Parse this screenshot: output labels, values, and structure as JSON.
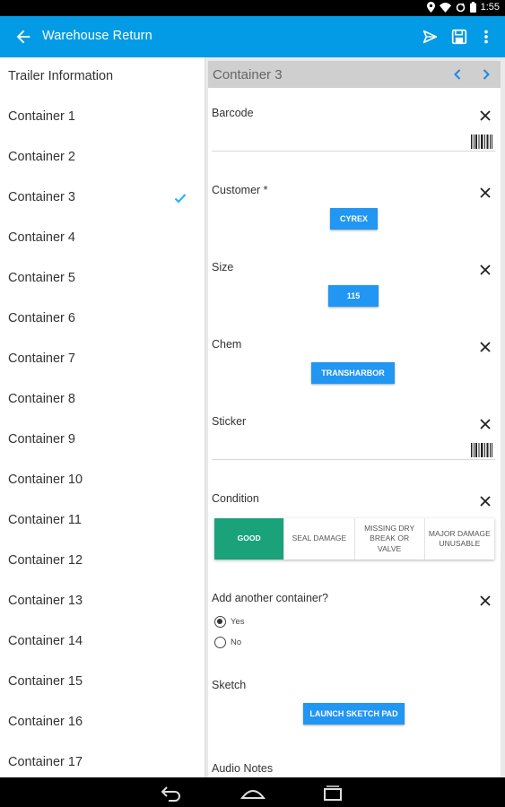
{
  "status_bar": {
    "time": "1:55",
    "icons": [
      "location-icon",
      "wifi-icon",
      "sync-icon",
      "battery-icon"
    ]
  },
  "app_bar": {
    "title": "Warehouse Return",
    "background": "#039be5",
    "actions": [
      "send-icon",
      "save-icon",
      "more-vert-icon"
    ]
  },
  "sidebar": {
    "items": [
      {
        "label": "Trailer Information",
        "checked": false
      },
      {
        "label": "Container 1",
        "checked": false
      },
      {
        "label": "Container 2",
        "checked": false
      },
      {
        "label": "Container 3",
        "checked": true
      },
      {
        "label": "Container 4",
        "checked": false
      },
      {
        "label": "Container 5",
        "checked": false
      },
      {
        "label": "Container 6",
        "checked": false
      },
      {
        "label": "Container 7",
        "checked": false
      },
      {
        "label": "Container 8",
        "checked": false
      },
      {
        "label": "Container 9",
        "checked": false
      },
      {
        "label": "Container 10",
        "checked": false
      },
      {
        "label": "Container 11",
        "checked": false
      },
      {
        "label": "Container 12",
        "checked": false
      },
      {
        "label": "Container 13",
        "checked": false
      },
      {
        "label": "Container 14",
        "checked": false
      },
      {
        "label": "Container 15",
        "checked": false
      },
      {
        "label": "Container 16",
        "checked": false
      },
      {
        "label": "Container 17",
        "checked": false
      }
    ]
  },
  "panel": {
    "title": "Container 3",
    "fields": {
      "barcode": {
        "label": "Barcode",
        "value": ""
      },
      "customer": {
        "label": "Customer *",
        "value": "CYREX"
      },
      "size": {
        "label": "Size",
        "value": "115"
      },
      "chem": {
        "label": "Chem",
        "value": "TRANSHARBOR"
      },
      "sticker": {
        "label": "Sticker",
        "value": ""
      },
      "condition": {
        "label": "Condition",
        "options": [
          "GOOD",
          "SEAL DAMAGE",
          "MISSING DRY BREAK OR VALVE",
          "MAJOR DAMAGE UNUSABLE"
        ],
        "selected": "GOOD"
      },
      "add_another": {
        "label": "Add another container?",
        "options": [
          "Yes",
          "No"
        ],
        "selected": "Yes"
      },
      "sketch": {
        "label": "Sketch",
        "button": "LAUNCH SKETCH PAD"
      },
      "audio": {
        "label": "Audio Notes"
      }
    }
  },
  "colors": {
    "accent": "#039be5",
    "chip": "#2196f3",
    "selected_segment": "#1aa37b",
    "check": "#29b6f6"
  },
  "nav_bar": {
    "buttons": [
      "back-icon",
      "home-icon",
      "recents-icon"
    ]
  }
}
